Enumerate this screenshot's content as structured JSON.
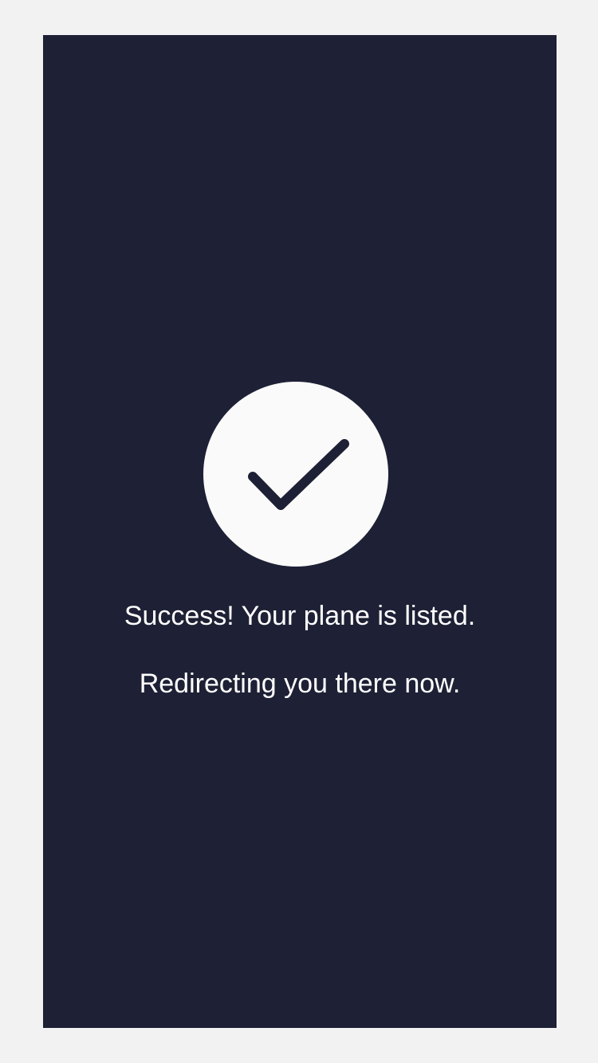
{
  "colors": {
    "background_outer": "#f2f2f2",
    "screen_background": "#1e2035",
    "circle_fill": "#fafafa",
    "check_stroke": "#1e2035",
    "text": "#ffffff"
  },
  "icon": {
    "name": "checkmark-icon"
  },
  "messages": {
    "success": "Success! Your plane is listed.",
    "redirect": "Redirecting you there now."
  }
}
